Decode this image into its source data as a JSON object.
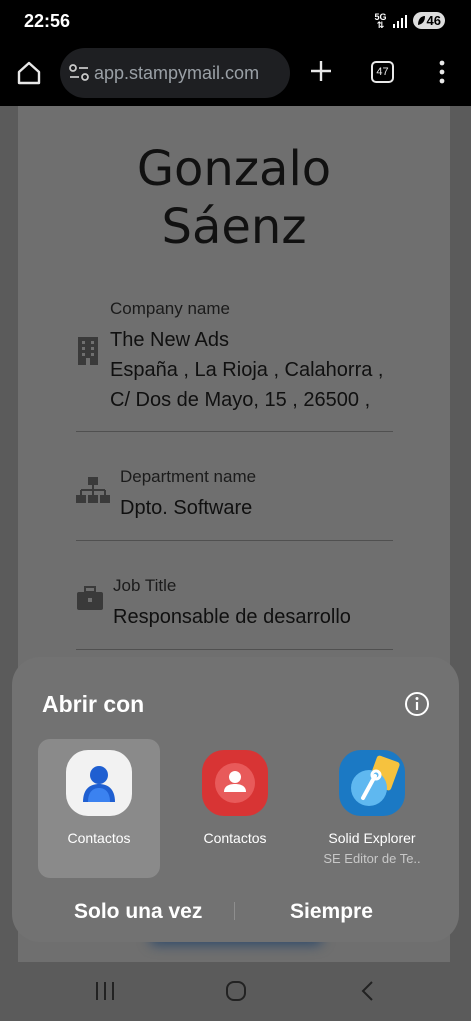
{
  "status_bar": {
    "time": "22:56",
    "network": "5G",
    "battery": "46"
  },
  "browser": {
    "url": "app.stampymail.com",
    "tab_count": "47",
    "icons": [
      "home-icon",
      "site-info-icon",
      "new-tab-icon",
      "tab-switcher-icon",
      "more-menu-icon"
    ]
  },
  "contact": {
    "name_line1": "Gonzalo",
    "name_line2": "Sáenz",
    "company": {
      "label": "Company name",
      "line1": "The New Ads",
      "line2": "España , La Rioja , Calahorra ,",
      "line3": "C/ Dos de Mayo, 15 , 26500 ,"
    },
    "department": {
      "label": "Department name",
      "value": "Dpto. Software"
    },
    "job": {
      "label": "Job Title",
      "value": "Responsable de desarrollo"
    }
  },
  "open_with_sheet": {
    "title": "Abrir con",
    "apps": [
      {
        "label": "Contactos",
        "sub": "",
        "selected": true,
        "color": "#3b6fd6"
      },
      {
        "label": "Contactos",
        "sub": "",
        "selected": false,
        "color": "#e03a3a"
      },
      {
        "label": "Solid Explorer",
        "sub": "SE Editor de Te..",
        "selected": false,
        "color": "#1f8ad6"
      }
    ],
    "once_label": "Solo una vez",
    "always_label": "Siempre"
  },
  "colors": {
    "scrim_page": "#5b5b5b",
    "sheet_bg": "#727272",
    "selected_option": "#8a8a8a"
  }
}
